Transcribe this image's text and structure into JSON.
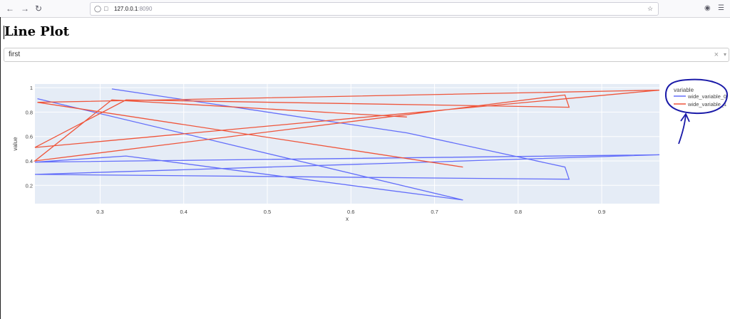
{
  "browser": {
    "url_host": "127.0.0.1",
    "url_port": ":8090",
    "back_icon": "back-arrow-icon",
    "forward_icon": "forward-arrow-icon",
    "reload_icon": "reload-icon",
    "shield_icon": "shield-icon",
    "page_icon": "page-icon",
    "bookmark_icon": "star-icon",
    "pocket_icon": "pocket-icon",
    "menu_icon": "hamburger-menu-icon"
  },
  "page": {
    "title": "Line Plot"
  },
  "dropdown": {
    "value": "first",
    "clear": "×",
    "arrow": "▾"
  },
  "chart_data": {
    "type": "line",
    "xlabel": "x",
    "ylabel": "value",
    "xlim": [
      0.222,
      0.969
    ],
    "ylim": [
      0.05,
      1.03
    ],
    "xticks": [
      "0.3",
      "0.4",
      "0.5",
      "0.6",
      "0.7",
      "0.8",
      "0.9"
    ],
    "xtick_values": [
      0.3,
      0.4,
      0.5,
      0.6,
      0.7,
      0.8,
      0.9
    ],
    "yticks": [
      "0.2",
      "0.4",
      "0.6",
      "0.8",
      "1"
    ],
    "ytick_values": [
      0.2,
      0.4,
      0.6,
      0.8,
      1.0
    ],
    "grid": true,
    "legend_title": "variable",
    "legend_placement": "right",
    "series": [
      {
        "name": "wide_variable_0",
        "color": "#636efa",
        "x": [
          0.314,
          0.667,
          0.856,
          0.861,
          0.222,
          0.969,
          0.222,
          0.331,
          0.734,
          0.225
        ],
        "y": [
          0.99,
          0.63,
          0.35,
          0.25,
          0.29,
          0.45,
          0.39,
          0.44,
          0.08,
          0.91
        ]
      },
      {
        "name": "wide_variable_1",
        "color": "#ef553b",
        "x": [
          0.734,
          0.225,
          0.969,
          0.222,
          0.331,
          0.861,
          0.856,
          0.222,
          0.314,
          0.667
        ],
        "y": [
          0.35,
          0.88,
          0.98,
          0.51,
          0.9,
          0.84,
          0.94,
          0.4,
          0.9,
          0.76
        ]
      }
    ]
  },
  "annotation_color": "#1a1aa8"
}
